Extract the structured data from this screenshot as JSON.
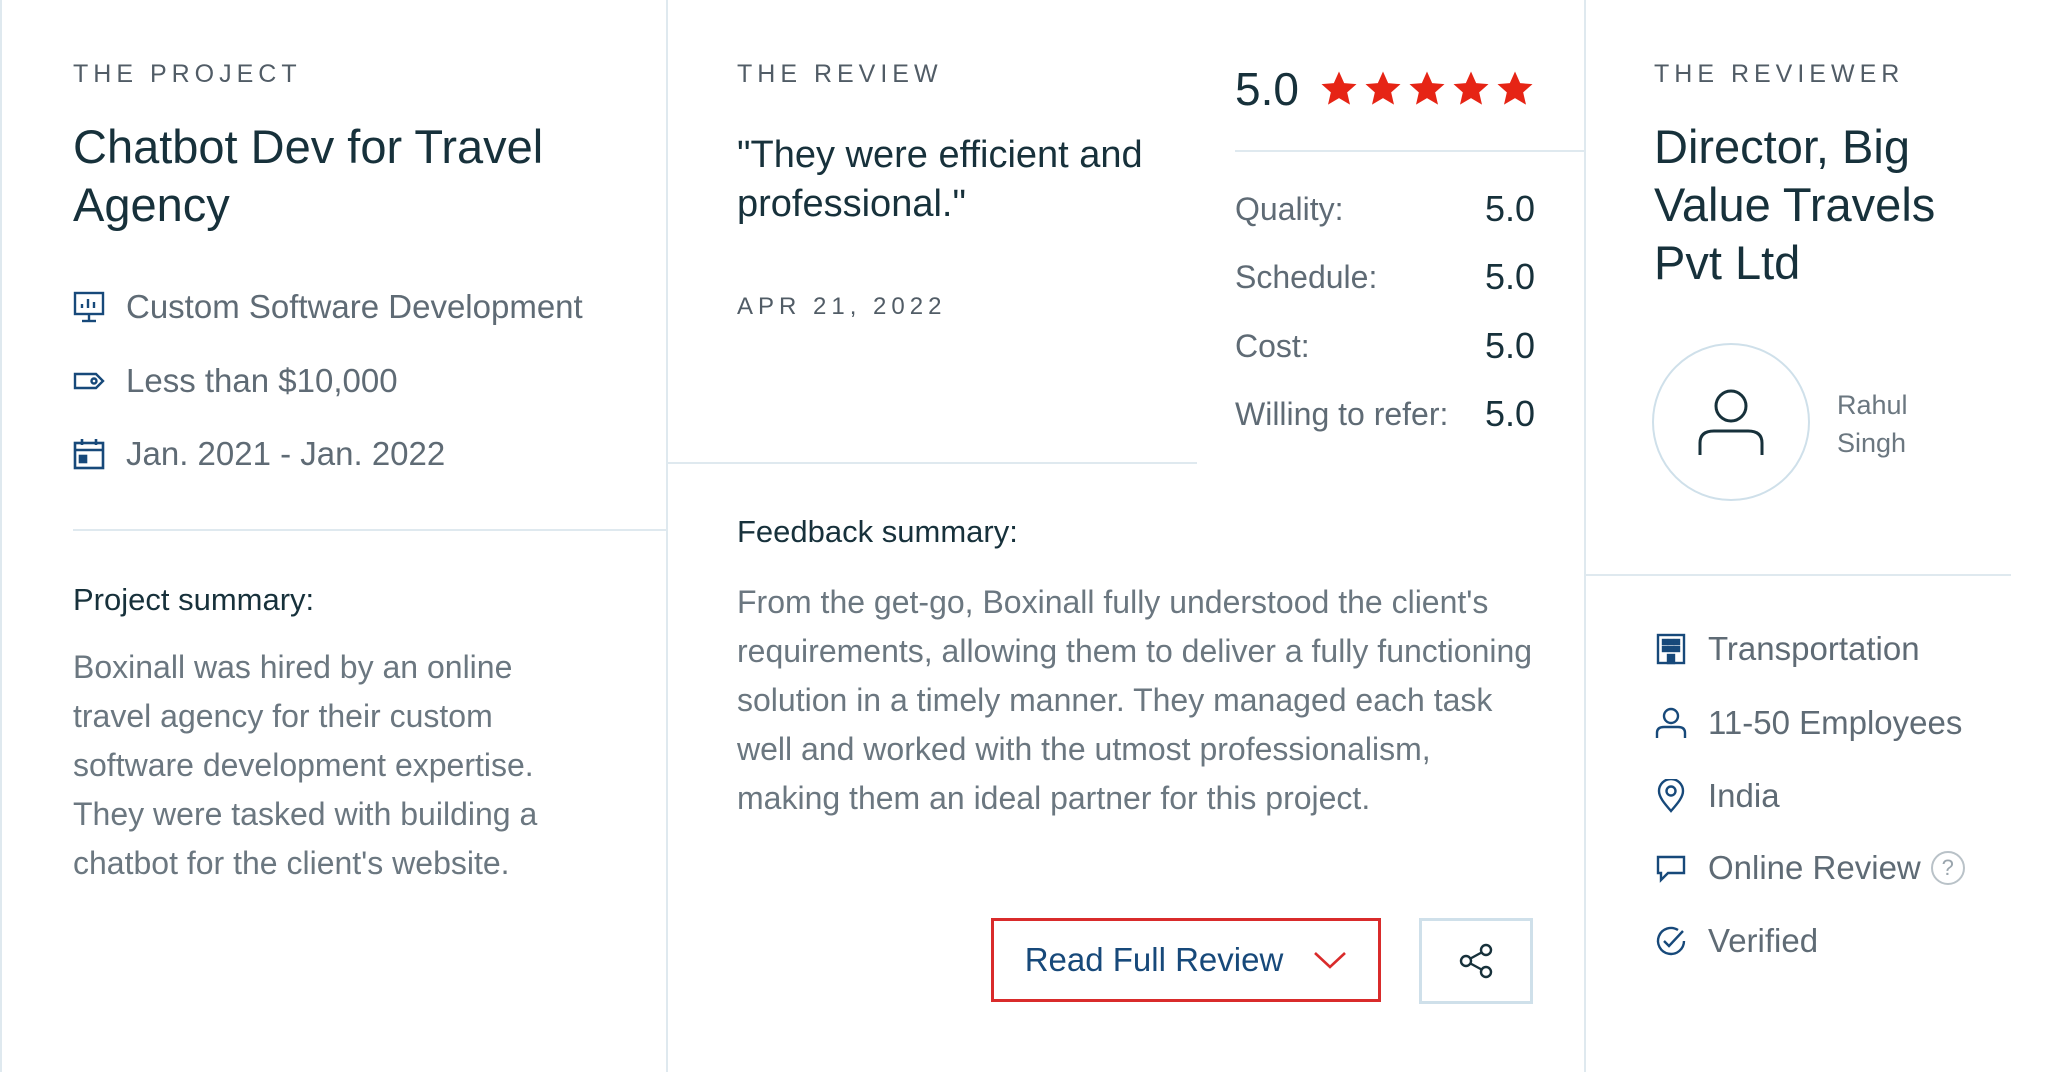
{
  "project": {
    "eyebrow": "THE PROJECT",
    "title": "Chatbot Dev for Travel Agency",
    "service": "Custom Software Development",
    "budget": "Less than $10,000",
    "dates": "Jan. 2021 - Jan. 2022",
    "summary_label": "Project summary:",
    "summary": "Boxinall was hired by an online travel agency for their custom software development expertise. They were tasked with building a chatbot for the client's website."
  },
  "review": {
    "eyebrow": "THE REVIEW",
    "quote": "\"They were efficient and professional.\"",
    "date": "APR 21, 2022",
    "overall": "5.0",
    "stars": 5,
    "ratings": [
      {
        "label": "Quality:",
        "value": "5.0"
      },
      {
        "label": "Schedule:",
        "value": "5.0"
      },
      {
        "label": "Cost:",
        "value": "5.0"
      },
      {
        "label": "Willing to refer:",
        "value": "5.0"
      }
    ],
    "feedback_label": "Feedback summary:",
    "feedback": "From the get-go, Boxinall fully understood the client's requirements, allowing them to deliver a fully functioning solution in a timely manner. They managed each task well and worked with the utmost professionalism, making them an ideal partner for this project.",
    "read_full_label": "Read Full Review"
  },
  "reviewer": {
    "eyebrow": "THE REVIEWER",
    "title": "Director, Big Value Travels Pvt Ltd",
    "first_name": "Rahul",
    "last_name": "Singh",
    "industry": "Transportation",
    "size": "11-50 Employees",
    "location": "India",
    "review_type": "Online Review",
    "help_glyph": "?",
    "status": "Verified"
  },
  "colors": {
    "star": "#e62415",
    "highlight_border": "#d92b2b",
    "link": "#17497a",
    "divider": "#dfe9ef"
  },
  "icons": [
    "monitor-chart-icon",
    "price-tag-icon",
    "calendar-icon",
    "star-icon",
    "chevron-down-icon",
    "share-icon",
    "user-icon",
    "building-icon",
    "location-pin-icon",
    "chat-bubble-icon",
    "help-icon",
    "check-circle-icon"
  ]
}
